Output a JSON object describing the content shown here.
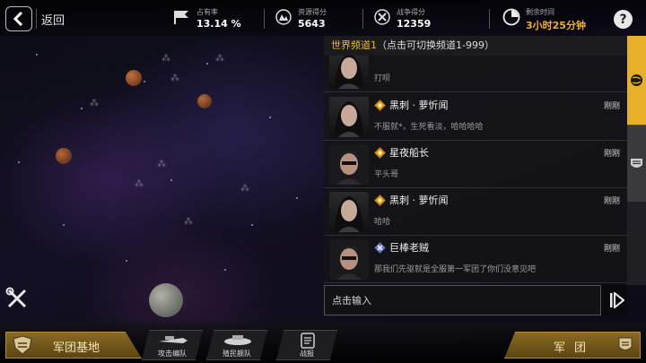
{
  "topbar": {
    "back_label": "返回",
    "occupancy": {
      "label": "占有率",
      "value": "13.14 %",
      "icon": "flag-icon"
    },
    "resource": {
      "label": "资源得分",
      "value": "5643",
      "icon": "resource-icon"
    },
    "war": {
      "label": "战争得分",
      "value": "12359",
      "icon": "war-icon"
    },
    "time_left": {
      "label": "剩余时间",
      "value": "3小时25分钟",
      "icon": "clock-icon"
    },
    "help_label": "?"
  },
  "chat": {
    "header_channel": "世界频道1",
    "header_hint": "（点击可切换频道1-999）",
    "messages": [
      {
        "name": "",
        "time": "",
        "text": "打呗",
        "rank": "gold-rank-badge"
      },
      {
        "name": "黑刺 · 萝忻闻",
        "time": "刚刚",
        "text": "不服就*，生死看淡，哈哈哈哈",
        "rank": "gold-rank-badge"
      },
      {
        "name": "星夜船长",
        "time": "刚刚",
        "text": "平头哥",
        "rank": "gold-rank-badge"
      },
      {
        "name": "黑刺 · 萝忻闻",
        "time": "刚刚",
        "text": "哈哈",
        "rank": "gold-rank-badge"
      },
      {
        "name": "巨棒老贼",
        "time": "刚刚",
        "text": "那我们先驱就是全服第一军团了你们没意见吧",
        "rank": "silver-rank-badge"
      }
    ],
    "input_placeholder": "点击输入"
  },
  "bottom": {
    "base_label": "军团基地",
    "attack_fleet_label": "攻击编队",
    "colony_fleet_label": "殖民舰队",
    "battle_report_label": "战报",
    "legion_label": "军团"
  },
  "colors": {
    "accent_gold": "#e8b028",
    "time_text": "#f0b030",
    "panel_bg": "#1c1c1e"
  }
}
